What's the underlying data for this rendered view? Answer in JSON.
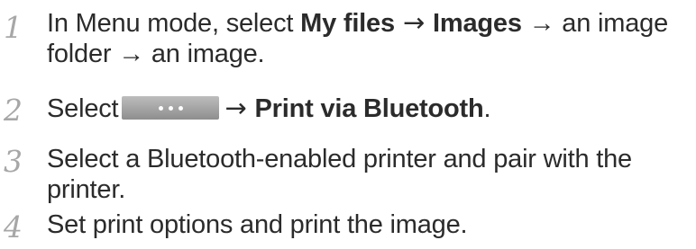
{
  "steps": [
    {
      "number": "1",
      "pre": "In Menu mode, select ",
      "b1": "My files",
      "arrow1": " → ",
      "b2": "Images",
      "post": " → an image folder → an image."
    },
    {
      "number": "2",
      "pre": "Select",
      "button_icon": "more-options-button",
      "arrow": "→ ",
      "bold": "Print via Bluetooth",
      "post": "."
    },
    {
      "number": "3",
      "text": "Select a Bluetooth-enabled printer and pair with the printer."
    },
    {
      "number": "4",
      "text": "Set print options and print the image."
    }
  ],
  "colors": {
    "step_number": "#a7a7a7",
    "body_text": "#2b2b2b",
    "button_bg": "#a5a5a5"
  }
}
